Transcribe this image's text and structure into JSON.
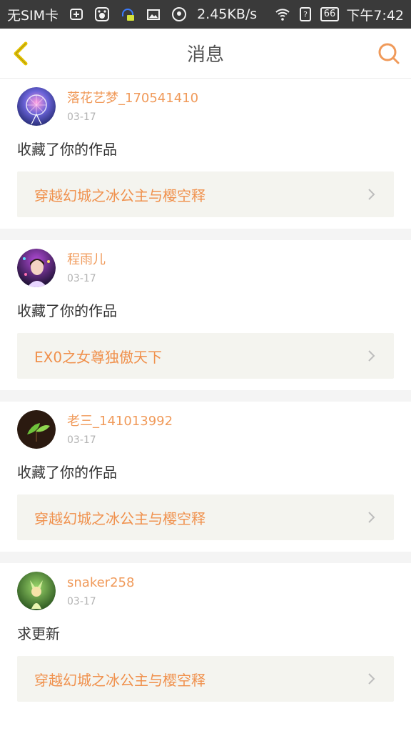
{
  "status_bar": {
    "carrier": "无SIM卡",
    "speed": "2.45KB/s",
    "battery": "66",
    "time": "下午7:42"
  },
  "header": {
    "title": "消息"
  },
  "messages": [
    {
      "username": "落花艺梦_170541410",
      "date": "03-17",
      "action": "收藏了你的作品",
      "work": "穿越幻城之冰公主与樱空释"
    },
    {
      "username": "程雨儿",
      "date": "03-17",
      "action": "收藏了你的作品",
      "work": "EX0之女尊独傲天下"
    },
    {
      "username": "老三_141013992",
      "date": "03-17",
      "action": "收藏了你的作品",
      "work": "穿越幻城之冰公主与樱空释"
    },
    {
      "username": "snaker258",
      "date": "03-17",
      "action": "求更新",
      "work": "穿越幻城之冰公主与樱空释"
    }
  ],
  "colors": {
    "accent": "#f09a5a",
    "back_arrow": "#e6c400",
    "work_bg": "#f4f4ef"
  }
}
